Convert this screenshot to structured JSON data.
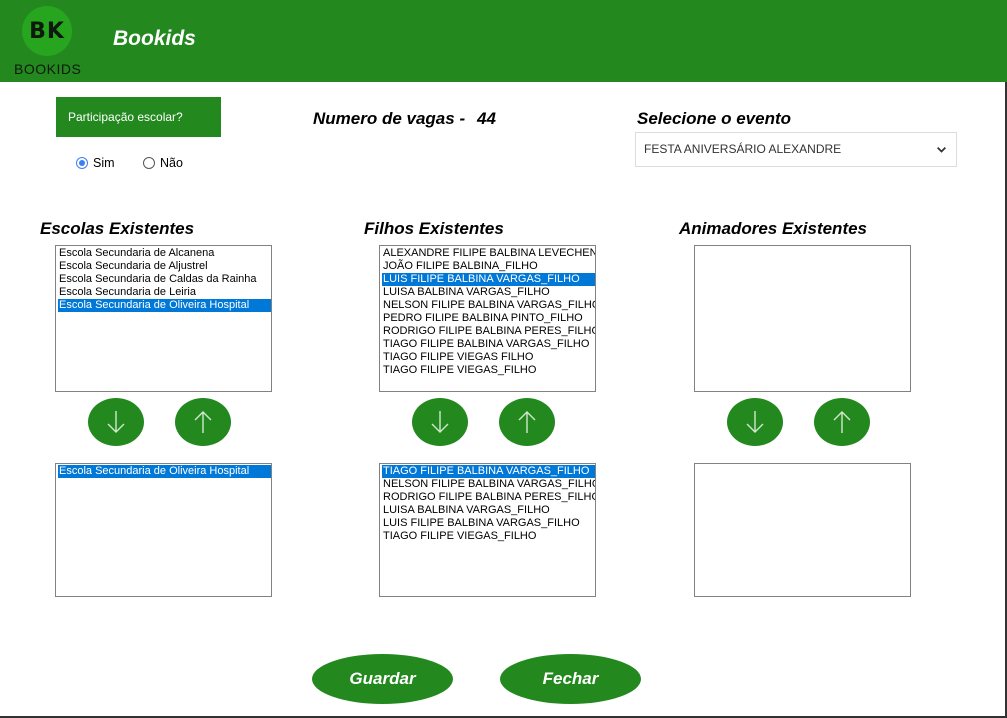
{
  "header": {
    "logo_text": "BK",
    "logo_word": "BOOKIDS",
    "title": "Bookids",
    "bg_color": "#23891f"
  },
  "participacao": {
    "label": "Participação escolar?",
    "options": [
      "Sim",
      "Não"
    ],
    "selected": "Sim"
  },
  "vagas": {
    "label": "Numero de vagas -",
    "value": "44"
  },
  "evento": {
    "label": "Selecione o evento",
    "selected": "FESTA ANIVERSÁRIO ALEXANDRE",
    "chevron_icon": "chevron-down-icon"
  },
  "escolas": {
    "heading": "Escolas Existentes",
    "available": [
      "Escola Secundaria de Alcanena",
      "Escola Secundaria de Aljustrel",
      "Escola Secundaria de Caldas da Rainha",
      "Escola Secundaria de Leiria",
      "Escola Secundaria de Oliveira Hospital"
    ],
    "available_selected_index": 4,
    "chosen": [
      "Escola Secundaria de Oliveira Hospital"
    ],
    "chosen_selected_index": 0
  },
  "filhos": {
    "heading": "Filhos Existentes",
    "available": [
      "ALEXANDRE FILIPE BALBINA LEVECHENKO_FILHO",
      "JOÃO FILIPE BALBINA_FILHO",
      "LUIS FILIPE BALBINA VARGAS_FILHO",
      "LUISA BALBINA VARGAS_FILHO",
      "NELSON FILIPE BALBINA VARGAS_FILHO",
      "PEDRO FILIPE BALBINA PINTO_FILHO",
      "RODRIGO FILIPE BALBINA PERES_FILHO",
      "TIAGO FILIPE BALBINA VARGAS_FILHO",
      "TIAGO FILIPE VIEGAS FILHO",
      "TIAGO FILIPE VIEGAS_FILHO"
    ],
    "available_selected_index": 2,
    "chosen": [
      "TIAGO FILIPE BALBINA VARGAS_FILHO",
      "NELSON FILIPE BALBINA VARGAS_FILHO",
      "RODRIGO FILIPE BALBINA PERES_FILHO",
      "LUISA BALBINA VARGAS_FILHO",
      "LUIS FILIPE BALBINA VARGAS_FILHO",
      "TIAGO FILIPE VIEGAS_FILHO"
    ],
    "chosen_selected_index": 0
  },
  "animadores": {
    "heading": "Animadores Existentes",
    "available": [],
    "chosen": []
  },
  "icons": {
    "move_down": "arrow-down-icon",
    "move_up": "arrow-up-icon"
  },
  "actions": {
    "save_label": "Guardar",
    "close_label": "Fechar"
  }
}
